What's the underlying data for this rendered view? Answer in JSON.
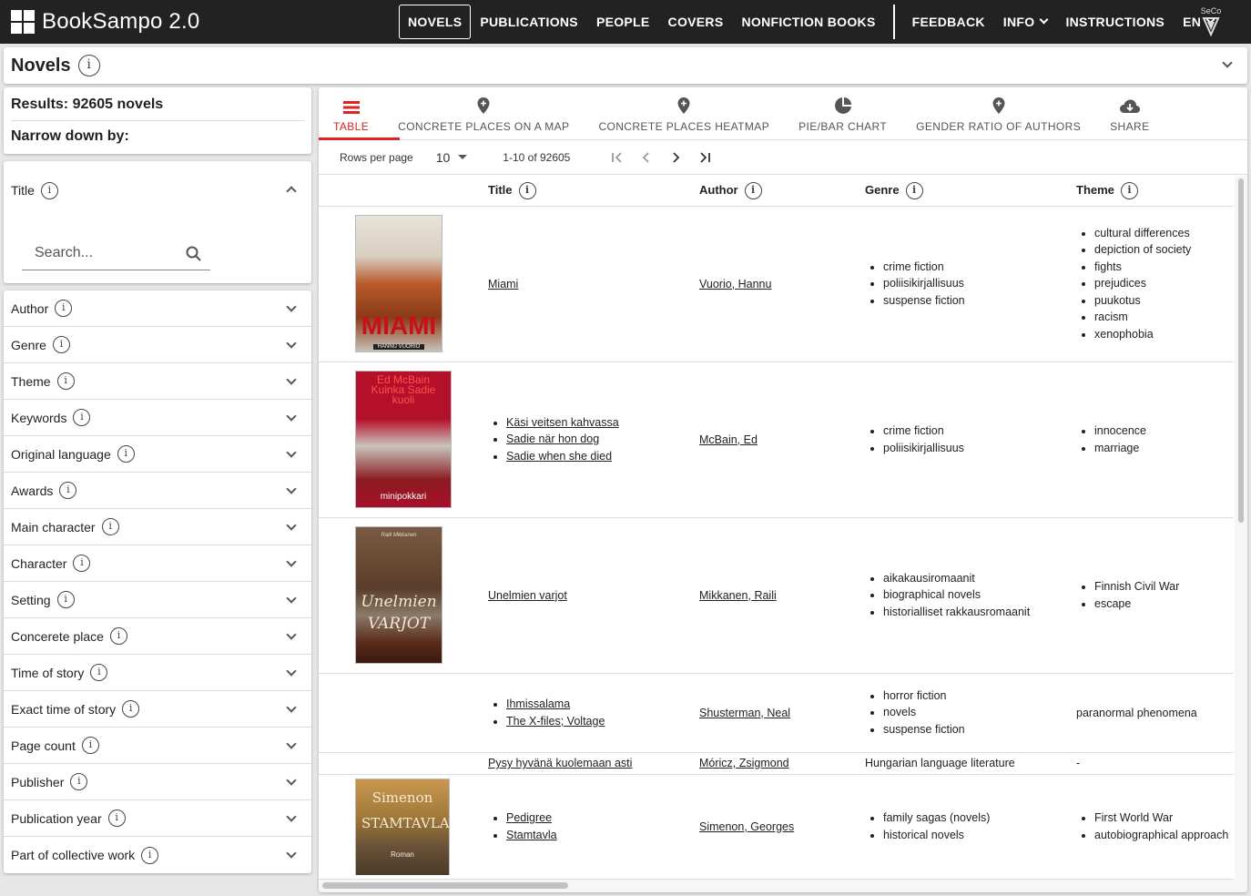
{
  "app": {
    "title": "BookSampo 2.0"
  },
  "nav": {
    "items": [
      "NOVELS",
      "PUBLICATIONS",
      "PEOPLE",
      "COVERS",
      "NONFICTION BOOKS"
    ],
    "feedback": "FEEDBACK",
    "info": "INFO",
    "instructions": "INSTRUCTIONS",
    "language": "EN",
    "seco_label": "SeCo"
  },
  "perspective": {
    "title": "Novels"
  },
  "results": {
    "label": "Results: 92605 novels",
    "narrow_label": "Narrow down by:"
  },
  "title_facet": {
    "label": "Title",
    "search_placeholder": "Search..."
  },
  "facets": [
    "Author",
    "Genre",
    "Theme",
    "Keywords",
    "Original language",
    "Awards",
    "Main character",
    "Character",
    "Setting",
    "Concerete place",
    "Time of story",
    "Exact time of story",
    "Page count",
    "Publisher",
    "Publication year",
    "Part of collective work"
  ],
  "tabs": [
    {
      "label": "TABLE",
      "icon": "table-icon"
    },
    {
      "label": "CONCRETE PLACES ON A MAP",
      "icon": "map-pin-icon"
    },
    {
      "label": "CONCRETE PLACES HEATMAP",
      "icon": "map-pin-icon"
    },
    {
      "label": "PIE/BAR CHART",
      "icon": "pie-chart-icon"
    },
    {
      "label": "GENDER RATIO OF AUTHORS",
      "icon": "map-pin-icon"
    },
    {
      "label": "SHARE",
      "icon": "cloud-download-icon"
    }
  ],
  "pager": {
    "rows_label": "Rows per page",
    "rows_value": "10",
    "range": "1-10 of 92605"
  },
  "columns": {
    "title": "Title",
    "author": "Author",
    "genre": "Genre",
    "theme": "Theme"
  },
  "rows": [
    {
      "cover": {
        "title": "MIAMI",
        "subtitle": "HANNU VUORIO",
        "bg": "#c9c2b8"
      },
      "titles": [
        "Miami"
      ],
      "author": "Vuorio, Hannu",
      "genres": [
        "crime fiction",
        "poliisikirjallisuus",
        "suspense fiction"
      ],
      "themes": [
        "cultural differences",
        "depiction of society",
        "fights",
        "prejudices",
        "puukotus",
        "racism",
        "xenophobia"
      ]
    },
    {
      "cover": {
        "title": "Ed McBain Kuinka Sadie kuoli",
        "subtitle": "minipokkari",
        "bg": "#a8102a"
      },
      "titles": [
        "Käsi veitsen kahvassa",
        "Sadie när hon dog",
        "Sadie when she died"
      ],
      "author": "McBain, Ed",
      "genres": [
        "crime fiction",
        "poliisikirjallisuus"
      ],
      "themes": [
        "innocence",
        "marriage"
      ]
    },
    {
      "cover": {
        "title": "Unelmien VARJOT",
        "subtitle": "Raili Mikkanen",
        "bg": "#6b4a35"
      },
      "titles": [
        "Unelmien varjot"
      ],
      "author": "Mikkanen, Raili",
      "genres": [
        "aikakausiromaanit",
        "biographical novels",
        "historialliset rakkausromaanit"
      ],
      "themes": [
        "Finnish Civil War",
        "escape"
      ]
    },
    {
      "cover": null,
      "titles": [
        "Ihmissalama",
        "The X-files; Voltage"
      ],
      "author": "Shusterman, Neal",
      "genres": [
        "horror fiction",
        "novels",
        "suspense fiction"
      ],
      "theme_text": "paranormal phenomena"
    },
    {
      "cover": null,
      "title_text": "Pysy hyvänä kuolemaan asti",
      "author": "Móricz, Zsigmond",
      "genre_text": "Hungarian language literature",
      "theme_text": "-"
    },
    {
      "cover": {
        "title": "Simenon STAMTAVLA",
        "subtitle": "Roman",
        "bg": "#b88a45"
      },
      "titles": [
        "Pedigree",
        "Stamtavla"
      ],
      "author": "Simenon, Georges",
      "genres": [
        "family sagas (novels)",
        "historical novels"
      ],
      "themes": [
        "First World War",
        "autobiographical approach"
      ]
    }
  ]
}
